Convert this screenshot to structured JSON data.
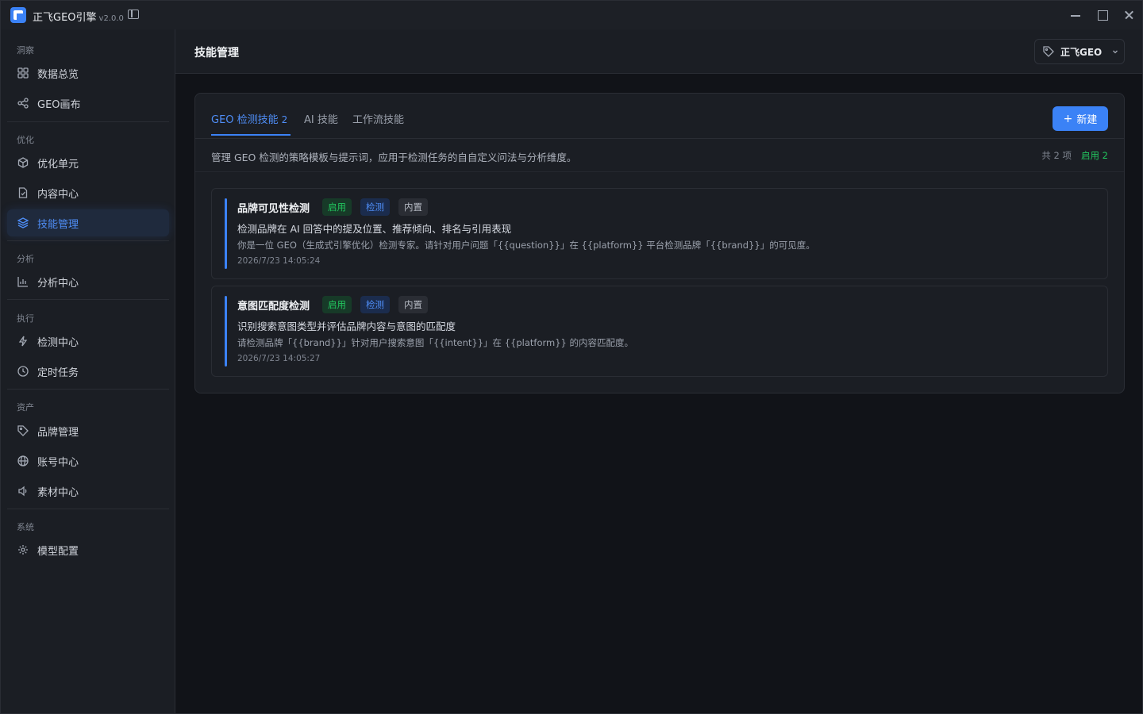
{
  "app": {
    "title": "正飞GEO引擎",
    "version": "v2.0.0"
  },
  "sidebar": {
    "groups": [
      {
        "title": "洞察",
        "items": [
          {
            "label": "数据总览",
            "icon": "grid-icon"
          },
          {
            "label": "GEO画布",
            "icon": "share-nodes-icon"
          }
        ]
      },
      {
        "title": "优化",
        "items": [
          {
            "label": "优化单元",
            "icon": "cube-icon"
          },
          {
            "label": "内容中心",
            "icon": "document-icon"
          },
          {
            "label": "技能管理",
            "icon": "layers-icon",
            "active": true
          }
        ]
      },
      {
        "title": "分析",
        "items": [
          {
            "label": "分析中心",
            "icon": "bar-chart-icon"
          }
        ]
      },
      {
        "title": "执行",
        "items": [
          {
            "label": "检测中心",
            "icon": "lightning-icon"
          },
          {
            "label": "定时任务",
            "icon": "clock-icon"
          }
        ]
      },
      {
        "title": "资产",
        "items": [
          {
            "label": "品牌管理",
            "icon": "tag-icon"
          },
          {
            "label": "账号中心",
            "icon": "globe-icon"
          },
          {
            "label": "素材中心",
            "icon": "speaker-icon"
          }
        ]
      },
      {
        "title": "系统",
        "items": [
          {
            "label": "模型配置",
            "icon": "gear-icon"
          }
        ]
      }
    ]
  },
  "header": {
    "title": "技能管理",
    "brand_selector": "正飞GEO"
  },
  "tabs": [
    {
      "label": "GEO 检测技能",
      "count": "2",
      "active": true
    },
    {
      "label": "AI 技能"
    },
    {
      "label": "工作流技能"
    }
  ],
  "new_button": "新建",
  "description": "管理 GEO 检测的策略模板与提示词，应用于检测任务的自自定义问法与分析维度。",
  "counts": {
    "total": "共 2 项",
    "enabled": "启用 2"
  },
  "colors": {
    "accent": "#3b82f6",
    "enabled": "#22c55e",
    "background": "#111318",
    "panel": "#1b1e24"
  },
  "skills": [
    {
      "name": "品牌可见性检测",
      "badges": [
        "启用",
        "检测",
        "内置"
      ],
      "description": "检测品牌在 AI 回答中的提及位置、推荐倾向、排名与引用表现",
      "prompt": "你是一位 GEO（生成式引擎优化）检测专家。请针对用户问题「{{question}}」在 {{platform}} 平台检测品牌「{{brand}}」的可见度。",
      "time": "2026/7/23 14:05:24"
    },
    {
      "name": "意图匹配度检测",
      "badges": [
        "启用",
        "检测",
        "内置"
      ],
      "description": "识别搜索意图类型并评估品牌内容与意图的匹配度",
      "prompt": "请检测品牌「{{brand}}」针对用户搜索意图「{{intent}}」在 {{platform}} 的内容匹配度。",
      "time": "2026/7/23 14:05:27"
    }
  ]
}
